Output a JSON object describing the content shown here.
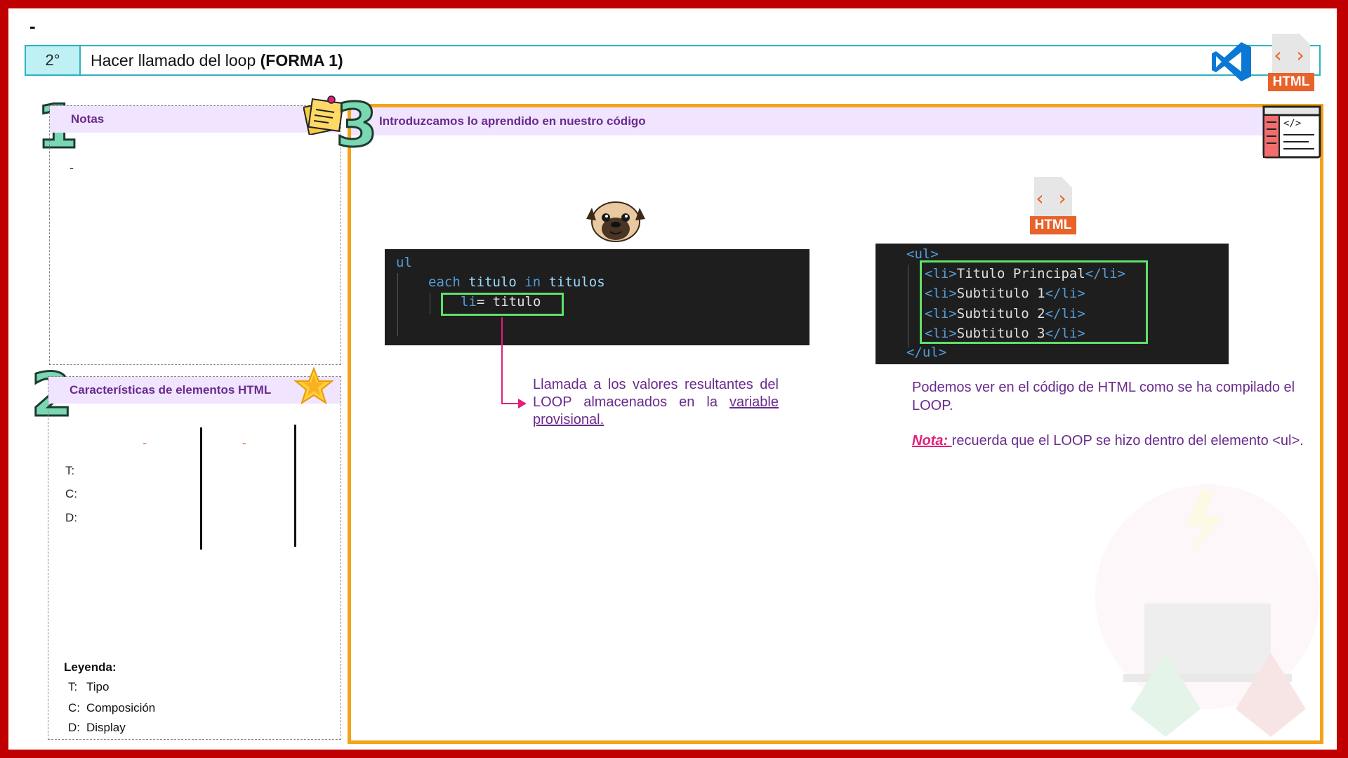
{
  "page": {
    "top_dash": "-"
  },
  "header": {
    "number": "2°",
    "title_plain": "Hacer llamado del loop ",
    "title_bold": "(FORMA 1)"
  },
  "icons": {
    "vscode": "vscode-icon",
    "html_file": "html-file-icon",
    "html_label": "HTML",
    "html_code_glyph": "‹ ›",
    "sticky_note": "sticky-note-icon",
    "star": "star-icon",
    "pug": "pug-icon",
    "code_editor": "code-editor-icon"
  },
  "notes": {
    "number": "1",
    "title": "Notas",
    "content": "-"
  },
  "characteristics": {
    "number": "2",
    "title": "Características de elementos HTML",
    "col_dashes": [
      "-",
      "-"
    ],
    "rows": [
      "T:",
      "C:",
      "D:"
    ],
    "legend_title": "Leyenda:",
    "legend": [
      {
        "key": "T:",
        "value": "Tipo"
      },
      {
        "key": "C:",
        "value": "Composición"
      },
      {
        "key": "D:",
        "value": "Display"
      }
    ]
  },
  "main": {
    "number": "3",
    "title": "Introduzcamos lo aprendido en nuestro código",
    "pug_code": {
      "line1": "ul",
      "line2_kw1": "each",
      "line2_id1": " titulo ",
      "line2_kw2": "in",
      "line2_id2": " titulos",
      "line3_tag": "li",
      "line3_rest": "= titulo"
    },
    "html_code": {
      "open_ul": "<ul>",
      "items": [
        "Titulo Principal",
        "Subtitulo 1",
        "Subtitulo 2",
        "Subtitulo 3"
      ],
      "li_open": "<li>",
      "li_close": "</li>",
      "close_ul": "</ul>"
    },
    "pug_explanation": {
      "text": "Llamada a los valores resultantes del LOOP almacenados en la ",
      "link": "variable provisional."
    },
    "html_explanation": "Podemos ver en el código de HTML como se ha compilado el LOOP.",
    "note_label": "Nota: ",
    "note_text": "recuerda que el LOOP se hizo dentro del elemento <ul>."
  },
  "colors": {
    "frame": "#c00000",
    "accent_orange": "#f5a21b",
    "header_teal": "#2bb3c0",
    "purple_text": "#6a2b8c",
    "pink": "#e0207a",
    "green_box": "#5fe06a"
  }
}
